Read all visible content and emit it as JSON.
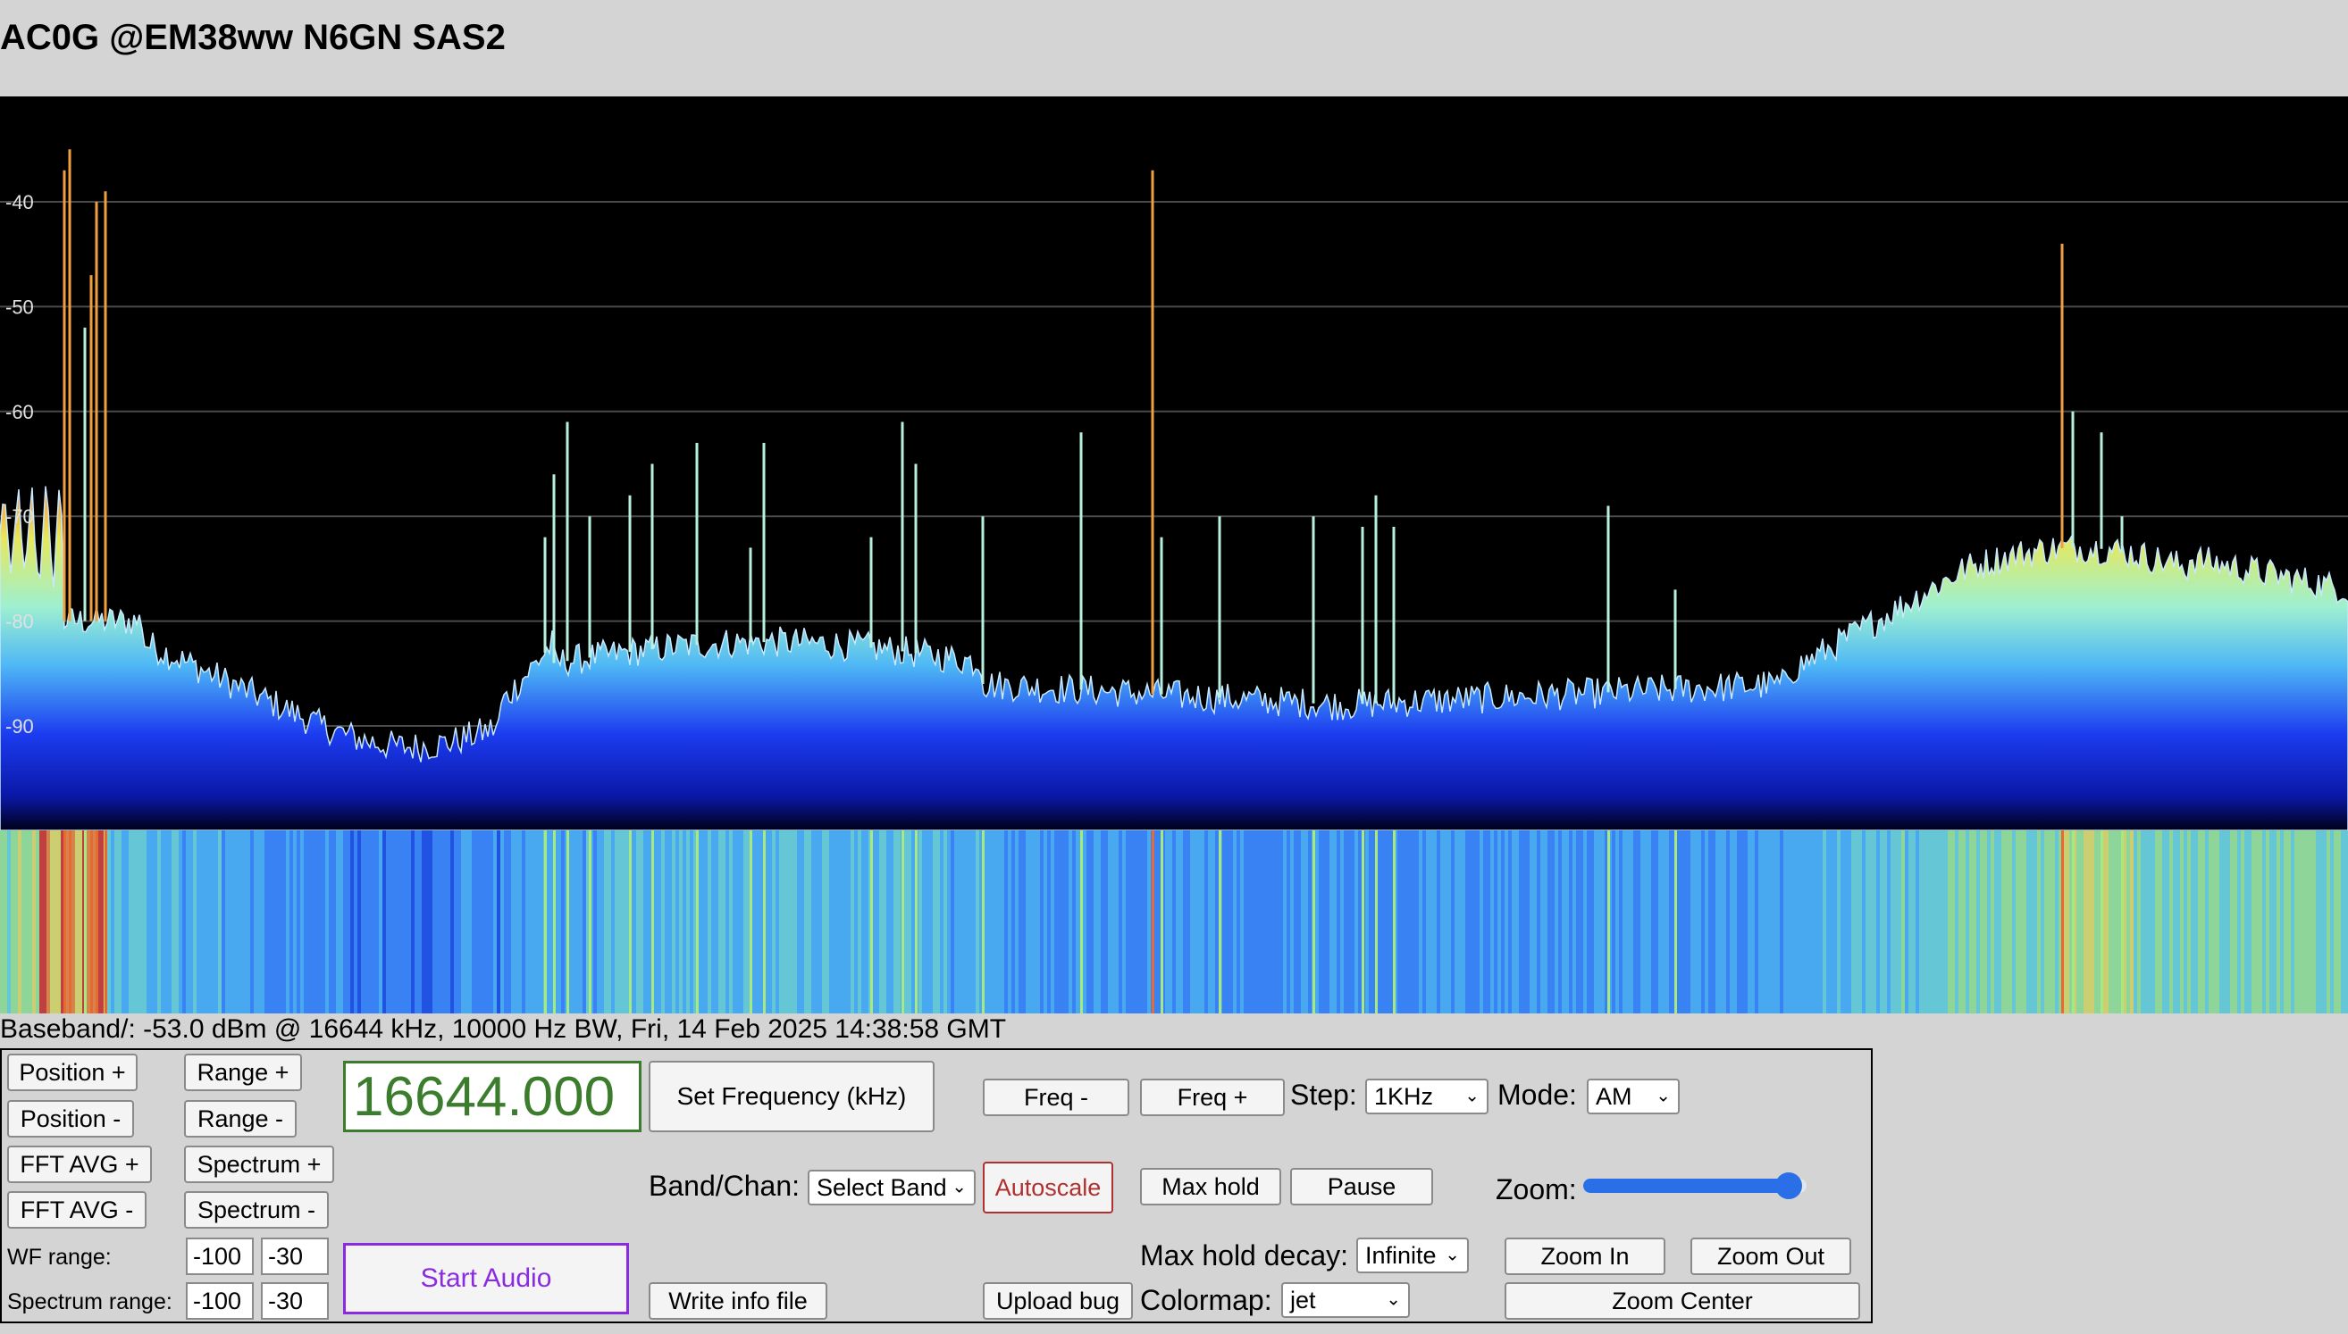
{
  "header": {
    "title": "AC0G @EM38ww N6GN SAS2"
  },
  "spectrum": {
    "y_ticks": [
      "-40",
      "-50",
      "-60",
      "-70",
      "-80",
      "-90"
    ],
    "y_values": [
      -40,
      -50,
      -60,
      -70,
      -80,
      -90
    ],
    "grid_color": "#4a4a4a",
    "background": "#000000",
    "fill_colors": {
      "top": "#9ef0d0",
      "mid": "#4fb8f5",
      "low": "#1c3cf0",
      "bottom": "#000018"
    },
    "colormap": "jet"
  },
  "status": {
    "text": "Baseband/: -53.0 dBm @ 16644 kHz, 10000 Hz BW, Fri, 14 Feb 2025 14:38:58 GMT"
  },
  "controls": {
    "position_plus": "Position +",
    "position_minus": "Position -",
    "fft_avg_plus": "FFT AVG +",
    "fft_avg_minus": "FFT AVG -",
    "range_plus": "Range +",
    "range_minus": "Range -",
    "spectrum_plus": "Spectrum +",
    "spectrum_minus": "Spectrum -",
    "wf_range_label": "WF range:",
    "wf_range_min": "-100",
    "wf_range_max": "-30",
    "spectrum_range_label": "Spectrum range:",
    "spectrum_range_min": "-100",
    "spectrum_range_max": "-30",
    "frequency_value": "16644.000",
    "set_frequency": "Set Frequency (kHz)",
    "band_chan_label": "Band/Chan:",
    "band_select": "Select Band",
    "autoscale": "Autoscale",
    "write_info": "Write info file",
    "start_audio": "Start Audio",
    "freq_minus": "Freq -",
    "freq_plus": "Freq +",
    "step_label": "Step:",
    "step_value": "1KHz",
    "mode_label": "Mode:",
    "mode_value": "AM",
    "max_hold": "Max hold",
    "pause": "Pause",
    "zoom_label": "Zoom:",
    "zoom_level": 0.92,
    "max_hold_decay_label": "Max hold decay:",
    "max_hold_decay_value": "Infinite",
    "upload_bug": "Upload bug",
    "colormap_label": "Colormap:",
    "colormap_value": "jet",
    "zoom_in": "Zoom In",
    "zoom_out": "Zoom Out",
    "zoom_center": "Zoom Center"
  }
}
